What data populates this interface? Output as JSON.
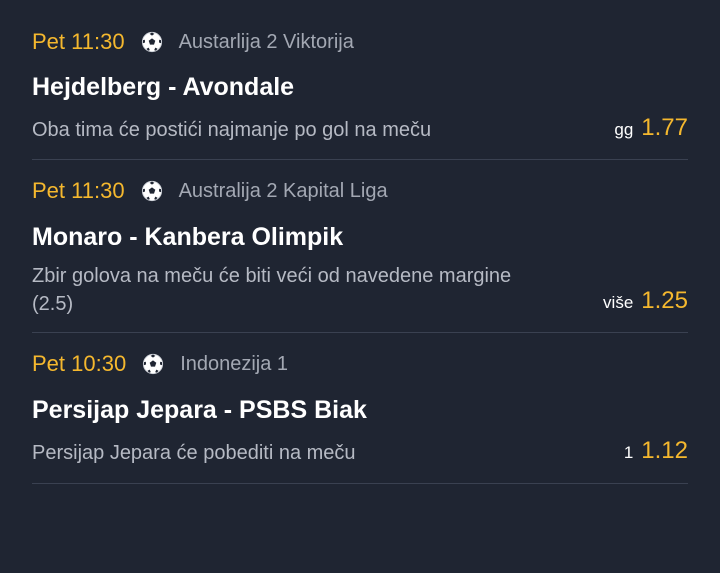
{
  "bets": [
    {
      "time": "Pet 11:30",
      "sport_icon": "soccer-ball-icon",
      "league": "Austarlija 2 Viktorija",
      "match": "Hejdelberg - Avondale",
      "market": "Oba tima će postići najmanje po gol na meču",
      "pick": "gg",
      "odd": "1.77"
    },
    {
      "time": "Pet 11:30",
      "sport_icon": "soccer-ball-icon",
      "league": "Australija 2 Kapital Liga",
      "match": "Monaro - Kanbera Olimpik",
      "market": "Zbir golova na meču će biti veći od navedene margine (2.5)",
      "pick": "više",
      "odd": "1.25"
    },
    {
      "time": "Pet 10:30",
      "sport_icon": "soccer-ball-icon",
      "league": "Indonezija 1",
      "match": "Persijap Jepara - PSBS Biak",
      "market": "Persijap Jepara će pobediti na meču",
      "pick": "1",
      "odd": "1.12"
    }
  ],
  "colors": {
    "background": "#1f2532",
    "accent": "#f5b82e",
    "divider": "#3a4151"
  }
}
